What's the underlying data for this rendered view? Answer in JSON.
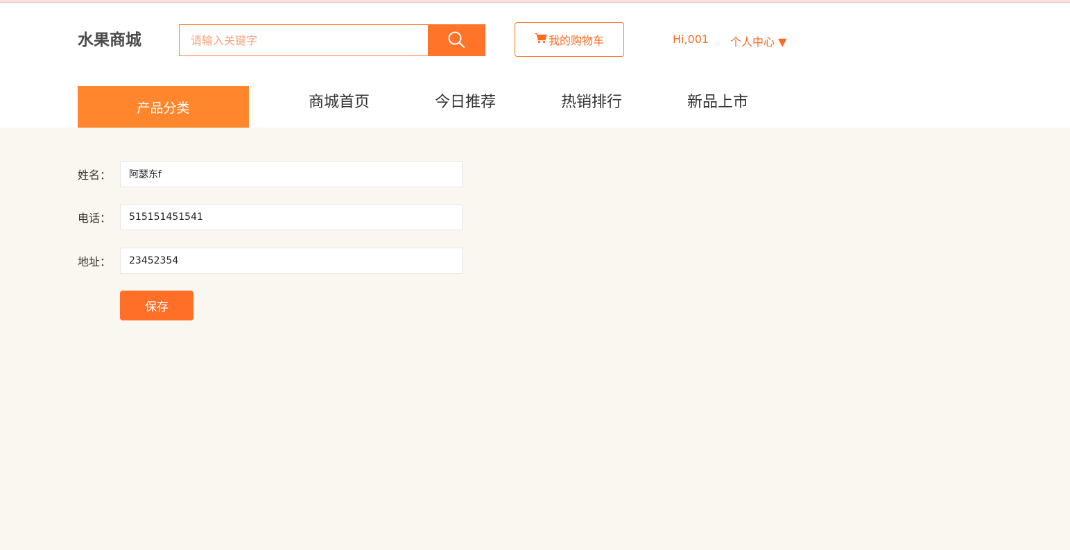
{
  "header": {
    "logo": "水果商城",
    "search": {
      "placeholder": "请输入关键字",
      "value": ""
    },
    "cart_label": "我的购物车",
    "greeting": "Hi,001",
    "user_center": "个人中心 ▼"
  },
  "nav": {
    "category": "产品分类",
    "links": [
      "商城首页",
      "今日推荐",
      "热销排行",
      "新品上市"
    ]
  },
  "form": {
    "name_label": "姓名：",
    "name_value": "阿瑟东f",
    "phone_label": "电话：",
    "phone_value": "515151451541",
    "address_label": "地址：",
    "address_value": "23452354",
    "save_label": "保存"
  },
  "colors": {
    "accent": "#ff7428",
    "nav_category_bg": "#ff862c",
    "page_bg": "#faf7f0"
  },
  "icons": [
    "search-icon",
    "cart-icon"
  ]
}
